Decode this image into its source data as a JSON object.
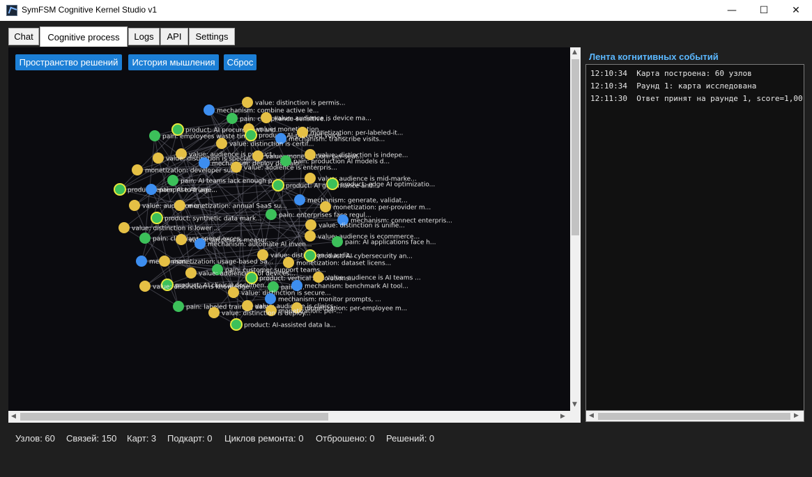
{
  "window": {
    "title": "SymFSM Cognitive Kernel Studio v1",
    "minimize": "—",
    "maximize": "☐",
    "close": "✕"
  },
  "tabs": [
    "Chat",
    "Cognitive process",
    "Logs",
    "API",
    "Settings"
  ],
  "toolbar": {
    "solution_space": "Пространство решений",
    "thinking_history": "История мышления",
    "reset": "Сброс"
  },
  "colors": {
    "mechanism": "#3d8ef0",
    "pain": "#3cc05a",
    "value": "#e5c045",
    "product_ring": "#e8e83c",
    "accent": "#1c7fd6"
  },
  "graph": {
    "nodes": [
      {
        "type": "value",
        "label": "value: distinction is permis..."
      },
      {
        "type": "mechanism",
        "label": "mechanism: combine active le..."
      },
      {
        "type": "pain",
        "label": "pain: compliance-sensitive..."
      },
      {
        "type": "value",
        "label": "value: audience is device ma..."
      },
      {
        "type": "product",
        "label": "product: AI procurement and..."
      },
      {
        "type": "pain",
        "label": "pain: employees waste time..."
      },
      {
        "type": "value",
        "label": "value: monetization..."
      },
      {
        "type": "product",
        "label": "product: AI-powered voice..."
      },
      {
        "type": "value",
        "label": "monetization: per-labeled-it..."
      },
      {
        "type": "mechanism",
        "label": "mechanism: transcribe visits..."
      },
      {
        "type": "value",
        "label": "value: distinction is certif..."
      },
      {
        "type": "value",
        "label": "value: audience is product..."
      },
      {
        "type": "value",
        "label": "value: distinction is special..."
      },
      {
        "type": "value",
        "label": "value: monetization: per-seat..."
      },
      {
        "type": "value",
        "label": "value: distinction is indepe..."
      },
      {
        "type": "mechanism",
        "label": "mechanism: deploy domain..."
      },
      {
        "type": "pain",
        "label": "pain: production AI models d..."
      },
      {
        "type": "value",
        "label": "monetization: developer sub..."
      },
      {
        "type": "value",
        "label": "value: audience is enterpris..."
      },
      {
        "type": "pain",
        "label": "pain: AI teams lack enough p..."
      },
      {
        "type": "value",
        "label": "value: audience is mid-marke..."
      },
      {
        "type": "product",
        "label": "product: enterprise AI use..."
      },
      {
        "type": "mechanism",
        "label": "pain: AI to triage..."
      },
      {
        "type": "product",
        "label": "product: AI governance and..."
      },
      {
        "type": "product",
        "label": "product: edge AI optimizatio..."
      },
      {
        "type": "value",
        "label": "value: audience is ..."
      },
      {
        "type": "value",
        "label": "monetization: annual SaaS su..."
      },
      {
        "type": "mechanism",
        "label": "mechanism: generate, validat..."
      },
      {
        "type": "value",
        "label": "monetization: per-provider m..."
      },
      {
        "type": "product",
        "label": "product: synthetic data mark..."
      },
      {
        "type": "pain",
        "label": "pain: enterprises face regul..."
      },
      {
        "type": "mechanism",
        "label": "mechanism: connect enterpris..."
      },
      {
        "type": "value",
        "label": "value: distinction is lower ..."
      },
      {
        "type": "value",
        "label": "value: distinction is unifie..."
      },
      {
        "type": "pain",
        "label": "pain: clinicians spend exces..."
      },
      {
        "type": "value",
        "label": "value: success is measur..."
      },
      {
        "type": "mechanism",
        "label": "mechanism: automate AI inven..."
      },
      {
        "type": "value",
        "label": "value: audience is ecommerce..."
      },
      {
        "type": "pain",
        "label": "pain: AI applications face h..."
      },
      {
        "type": "mechanism",
        "label": "mechanism: ..."
      },
      {
        "type": "value",
        "label": "monetization: usage-based Sa..."
      },
      {
        "type": "value",
        "label": "value: distinction is audit..."
      },
      {
        "type": "product",
        "label": "product: AI cybersecurity an..."
      },
      {
        "type": "value",
        "label": "monetization: dataset licens..."
      },
      {
        "type": "pain",
        "label": "pain: customer support teams..."
      },
      {
        "type": "value",
        "label": "value: audience is of devices..."
      },
      {
        "type": "product",
        "label": "product: vertical AI solutions..."
      },
      {
        "type": "value",
        "label": "value: audience is AI teams ..."
      },
      {
        "type": "product",
        "label": "product: AI clinical documen..."
      },
      {
        "type": "value",
        "label": "value: distinction is knowledge..."
      },
      {
        "type": "pain",
        "label": "pain: ..."
      },
      {
        "type": "mechanism",
        "label": "mechanism: benchmark AI tool..."
      },
      {
        "type": "value",
        "label": "value: distinction is secure..."
      },
      {
        "type": "mechanism",
        "label": "mechanism: monitor prompts, ..."
      },
      {
        "type": "pain",
        "label": "pain: labeled training data..."
      },
      {
        "type": "value",
        "label": "value: audience is clinics..."
      },
      {
        "type": "value",
        "label": "monetization: per-employee m..."
      },
      {
        "type": "value",
        "label": "monetization: per-..."
      },
      {
        "type": "value",
        "label": "value: distinction is deploy..."
      },
      {
        "type": "product",
        "label": "product: AI-assisted data la..."
      }
    ]
  },
  "feed": {
    "title": "Лента когнитивных событий",
    "lines": [
      "12:10:34  Карта построена: 60 узлов",
      "12:10:34  Раунд 1: карта исследована",
      "12:11:30  Ответ принят на раунде 1, score=1,00"
    ]
  },
  "status": {
    "nodes": "Узлов: 60",
    "edges": "Связей: 150",
    "maps": "Карт: 3",
    "submaps": "Подкарт: 0",
    "repair_cycles": "Циклов ремонта: 0",
    "discarded": "Отброшено: 0",
    "solutions": "Решений: 0"
  }
}
